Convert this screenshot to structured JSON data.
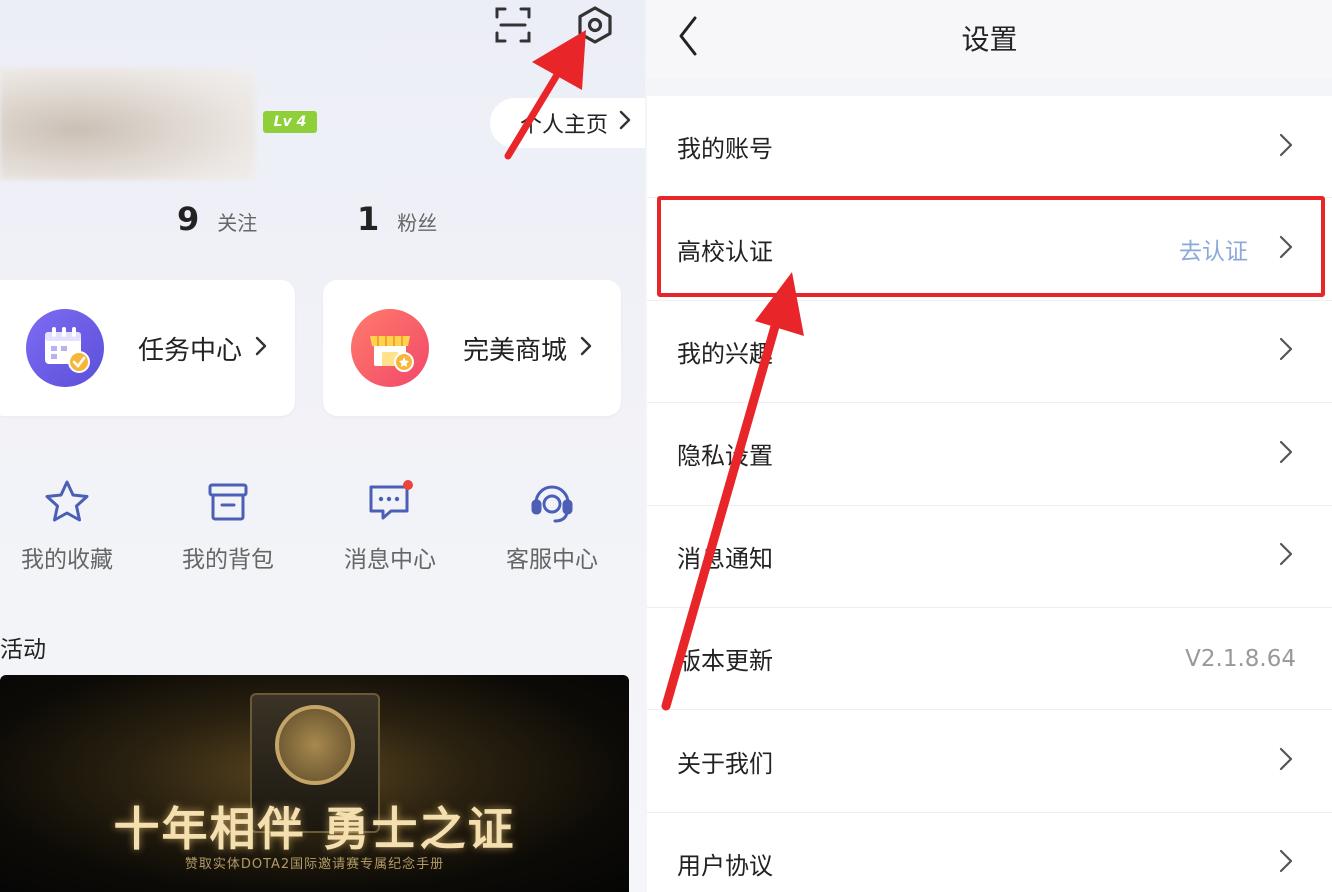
{
  "profile": {
    "level_badge": "Lv 4",
    "homepage_link": "个人主页",
    "follow_count": "9",
    "follow_label": "关注",
    "fans_count": "1",
    "fans_label": "粉丝"
  },
  "cards": {
    "task_center": "任务中心",
    "shop": "完美商城"
  },
  "quick_actions": {
    "favorites": "我的收藏",
    "backpack": "我的背包",
    "messages": "消息中心",
    "support": "客服中心"
  },
  "activity": {
    "section_title": "活动",
    "banner_title": "十年相伴 勇士之证",
    "banner_subtitle": "赞取实体DOTA2国际邀请赛专属纪念手册"
  },
  "settings": {
    "title": "设置",
    "rows": [
      {
        "label": "我的账号",
        "value": ""
      },
      {
        "label": "高校认证",
        "value": "去认证"
      },
      {
        "label": "我的兴趣",
        "value": ""
      },
      {
        "label": "隐私设置",
        "value": ""
      },
      {
        "label": "消息通知",
        "value": ""
      },
      {
        "label": "版本更新",
        "value": "V2.1.8.64"
      },
      {
        "label": "关于我们",
        "value": ""
      },
      {
        "label": "用户协议",
        "value": ""
      }
    ]
  },
  "colors": {
    "highlight": "#e8262a",
    "accent_link": "#8aa8d8",
    "level_badge": "#8fd03a",
    "icon_blue": "#4a5fb5"
  }
}
